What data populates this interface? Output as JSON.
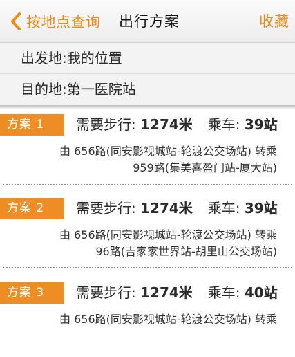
{
  "nav": {
    "back_label": "按地点查询",
    "title": "出行方案",
    "favorite_label": "收藏",
    "accent": "#f08a19"
  },
  "route": {
    "from_label": "出发地:",
    "from_value": "我的位置",
    "to_label": "目的地:",
    "to_value": "第一医院站"
  },
  "plans": [
    {
      "tag": "方案 1",
      "walk_label": "需要步行:",
      "walk_value": "1274米",
      "ride_label": "乘车:",
      "ride_value": "39站",
      "line1": "由 656路(同安影视城站-轮渡公交场站) 转乘",
      "line2": "959路(集美喜盈门站-厦大站)"
    },
    {
      "tag": "方案 2",
      "walk_label": "需要步行:",
      "walk_value": "1274米",
      "ride_label": "乘车:",
      "ride_value": "39站",
      "line1": "由 656路(同安影视城站-轮渡公交场站) 转乘",
      "line2": "96路(吉家家世界站-胡里山公交场站)"
    },
    {
      "tag": "方案 3",
      "walk_label": "需要步行:",
      "walk_value": "1274米",
      "ride_label": "乘车:",
      "ride_value": "40站",
      "line1": "由 656路(同安影视城站-轮渡公交场站) 转乘",
      "line2": ""
    }
  ]
}
